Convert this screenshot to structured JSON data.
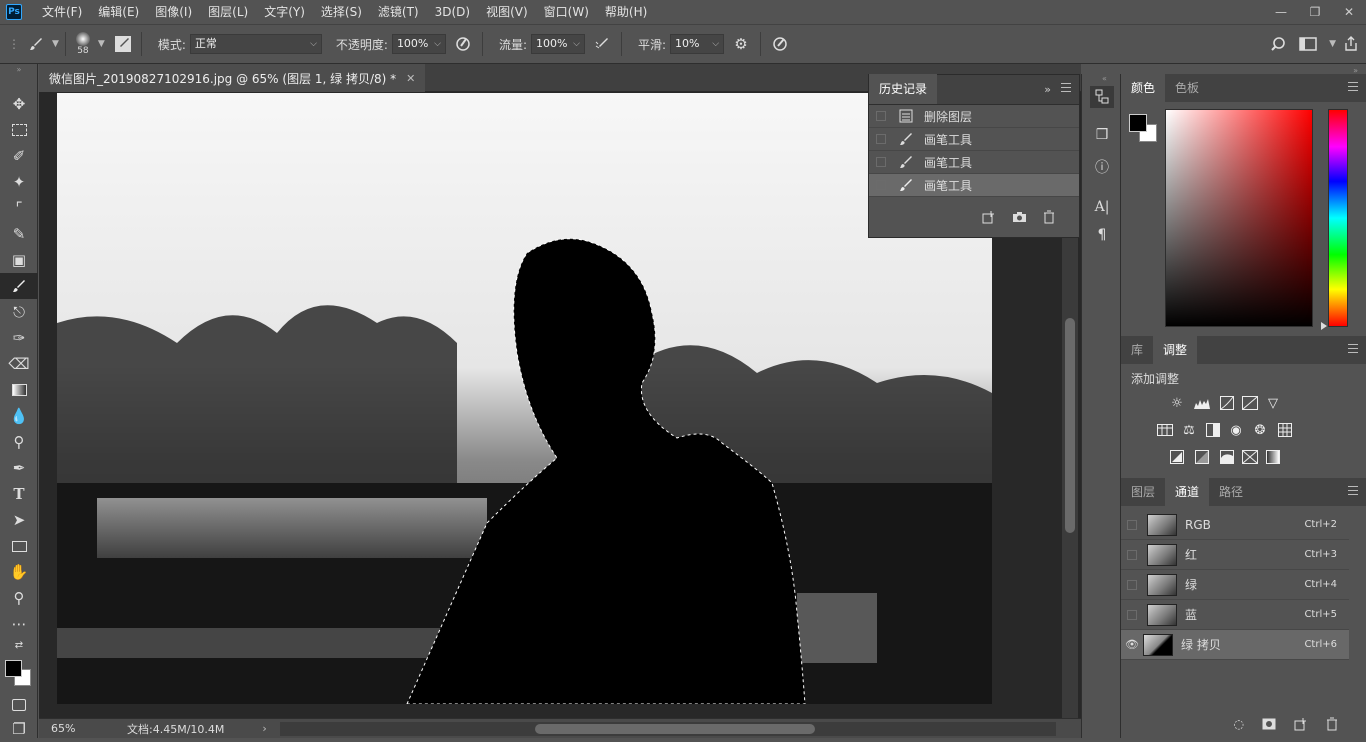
{
  "app": {
    "logo": "Ps"
  },
  "menu": [
    "文件(F)",
    "编辑(E)",
    "图像(I)",
    "图层(L)",
    "文字(Y)",
    "选择(S)",
    "滤镜(T)",
    "3D(D)",
    "视图(V)",
    "窗口(W)",
    "帮助(H)"
  ],
  "options": {
    "brush_size": "58",
    "mode_label": "模式:",
    "mode_value": "正常",
    "opacity_label": "不透明度:",
    "opacity_value": "100%",
    "flow_label": "流量:",
    "flow_value": "100%",
    "smooth_label": "平滑:",
    "smooth_value": "10%"
  },
  "document": {
    "tab_title": "微信图片_20190827102916.jpg @ 65% (图层 1, 绿 拷贝/8) *",
    "zoom": "65%",
    "doc_info": "文档:4.45M/10.4M"
  },
  "history": {
    "title": "历史记录",
    "items": [
      {
        "label": "删除图层",
        "icon": "layer-doc-icon"
      },
      {
        "label": "画笔工具",
        "icon": "brush-icon"
      },
      {
        "label": "画笔工具",
        "icon": "brush-icon"
      },
      {
        "label": "画笔工具",
        "icon": "brush-icon"
      }
    ],
    "selected_index": 3
  },
  "color_panel": {
    "tabs": [
      "颜色",
      "色板"
    ],
    "active": "颜色",
    "foreground": "#000000",
    "background": "#ffffff",
    "hue": "#ff0000"
  },
  "adjust_panel": {
    "tabs": [
      "库",
      "调整"
    ],
    "active": "调整",
    "heading": "添加调整"
  },
  "channels_panel": {
    "tabs": [
      "图层",
      "通道",
      "路径"
    ],
    "active": "通道",
    "rows": [
      {
        "name": "RGB",
        "shortcut": "Ctrl+2",
        "visible": false
      },
      {
        "name": "红",
        "shortcut": "Ctrl+3",
        "visible": false
      },
      {
        "name": "绿",
        "shortcut": "Ctrl+4",
        "visible": false
      },
      {
        "name": "蓝",
        "shortcut": "Ctrl+5",
        "visible": false
      },
      {
        "name": "绿 拷贝",
        "shortcut": "Ctrl+6",
        "visible": true
      }
    ]
  }
}
